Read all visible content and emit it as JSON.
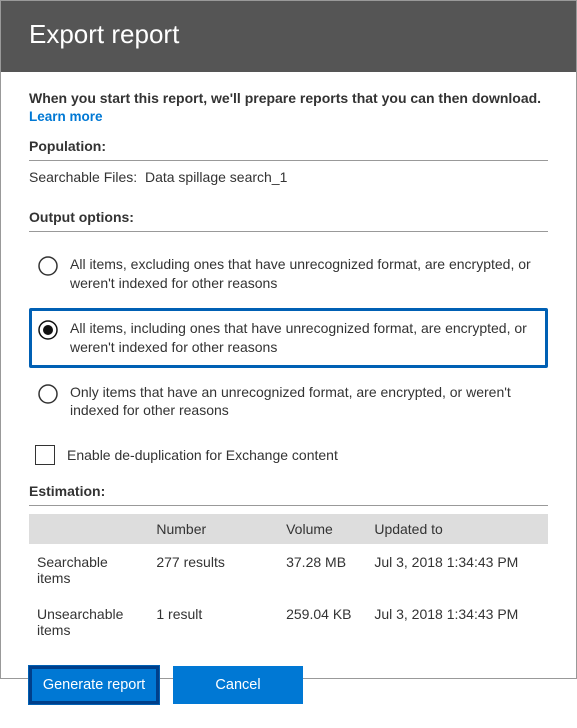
{
  "header": {
    "title": "Export report"
  },
  "intro": {
    "text": "When you start this report, we'll prepare reports that you can then download.",
    "learn_more": "Learn more"
  },
  "population": {
    "label": "Population:",
    "row_label": "Searchable Files:",
    "row_value": "Data spillage search_1"
  },
  "output": {
    "label": "Output options:",
    "options": [
      {
        "label": "All items, excluding ones that have unrecognized format, are encrypted, or weren't indexed for other reasons",
        "selected": false
      },
      {
        "label": "All items, including ones that have unrecognized format, are encrypted, or weren't indexed for other reasons",
        "selected": true
      },
      {
        "label": "Only items that have an unrecognized format, are encrypted, or weren't indexed for other reasons",
        "selected": false
      }
    ],
    "checkbox_label": "Enable de-duplication for Exchange content"
  },
  "estimation": {
    "label": "Estimation:",
    "columns": [
      "",
      "Number",
      "Volume",
      "Updated to"
    ],
    "rows": [
      {
        "label": "Searchable items",
        "number": "277 results",
        "volume": "37.28 MB",
        "updated": "Jul 3, 2018 1:34:43 PM"
      },
      {
        "label": "Unsearchable items",
        "number": "1 result",
        "volume": "259.04 KB",
        "updated": "Jul 3, 2018 1:34:43 PM"
      }
    ]
  },
  "buttons": {
    "generate": "Generate report",
    "cancel": "Cancel"
  }
}
